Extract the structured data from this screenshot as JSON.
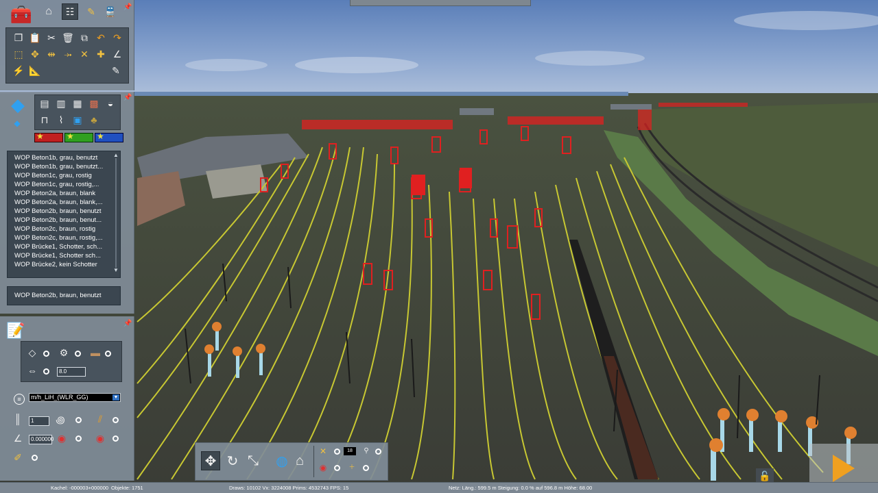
{
  "asset_list": {
    "items": [
      "WOP Beton1b, grau, benutzt",
      "WOP Beton1b, grau, benutzt...",
      "WOP Beton1c, grau, rostig",
      "WOP Beton1c, grau, rostig,...",
      "WOP Beton2a, braun, blank",
      "WOP Beton2a, braun, blank,...",
      "WOP Beton2b, braun, benutzt",
      "WOP Beton2b, braun, benut...",
      "WOP Beton2c, braun, rostig",
      "WOP Beton2c, braun, rostig,...",
      "WOP Brücke1, Schotter, sch...",
      "WOP Brücke1, Schotter sch...",
      "WOP Brücke2, kein Schotter"
    ],
    "selected": "WOP Beton2b, braun, benutzt"
  },
  "track_settings": {
    "spline_type": "m/h_LiH_(WLR_GG)",
    "width_value": "8.0",
    "count_value": "1",
    "gradient_value": "0.000000"
  },
  "bottom_toolbar": {
    "counter_value": "18"
  },
  "status_bar": {
    "tile": "Kachel: -000003+000000",
    "objects": "Objekte: 1751",
    "render_stats": "Draws: 10102 Vx: 3224008 Prims: 4532743 FPS: 15",
    "network": "Netz:  Läng.: 599.5 m  Steigung:  0.0 % auf 596.8 m  Höhe: 68.00"
  },
  "colors": {
    "panel_bg": "#808c98",
    "panel_inner": "#48535d",
    "list_bg": "#3b4650",
    "accent_red": "#e02020",
    "accent_green": "#3aa020",
    "accent_blue": "#2050c0",
    "accent_orange": "#f0a020",
    "track_yellow": "#c8c832"
  }
}
